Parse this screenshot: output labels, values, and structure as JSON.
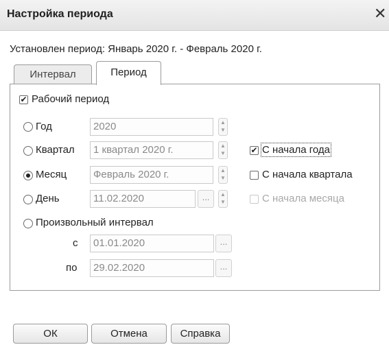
{
  "window": {
    "title": "Настройка периода",
    "close_glyph": "✕"
  },
  "period_summary": "Установлен период: Январь 2020 г. - Февраль 2020 г.",
  "tabs": {
    "interval": "Интервал",
    "period": "Период"
  },
  "work_period": {
    "label": "Рабочий период",
    "checked": true
  },
  "options": {
    "year": {
      "label": "Год",
      "value": "2020",
      "selected": false
    },
    "quarter": {
      "label": "Квартал",
      "value": "1 квартал 2020 г.",
      "selected": false
    },
    "month": {
      "label": "Месяц",
      "value": "Февраль 2020 г.",
      "selected": true
    },
    "day": {
      "label": "День",
      "value": "11.02.2020",
      "selected": false
    },
    "custom": {
      "label": "Произвольный интервал",
      "selected": false,
      "from_label": "с",
      "from_value": "01.01.2020",
      "to_label": "по",
      "to_value": "29.02.2020"
    }
  },
  "from_start": {
    "year": {
      "label": "С начала года",
      "checked": true
    },
    "quarter": {
      "label": "С начала квартала",
      "checked": false
    },
    "month": {
      "label": "С начала месяца",
      "checked": false,
      "disabled": true
    }
  },
  "buttons": {
    "ok": "ОК",
    "cancel": "Отмена",
    "help": "Справка"
  },
  "glyphs": {
    "check": "✔",
    "spin_up": "▲",
    "spin_down": "▼",
    "ellipsis": "..."
  },
  "icons": {
    "close": "close-icon",
    "spin": "spinner-icon",
    "select": "ellipsis-icon"
  },
  "colors": {
    "title_bg": "#e9e9e9",
    "border": "#9b9b9b",
    "disabled_text": "#a8a8a8"
  }
}
